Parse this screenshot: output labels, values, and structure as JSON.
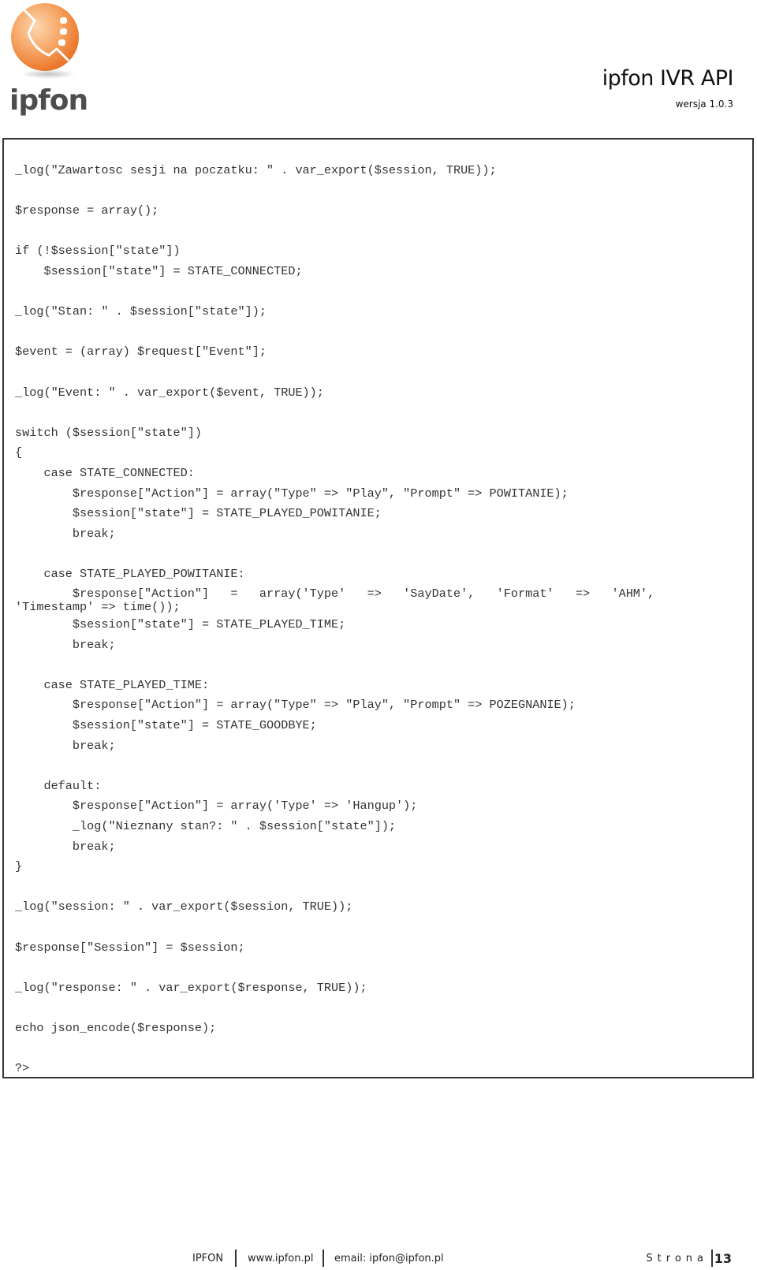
{
  "header": {
    "logo_text": "ipfon",
    "title": "ipfon IVR API",
    "version": "wersja 1.0.3"
  },
  "code": {
    "language": "php",
    "lines": [
      "_log(\"Zawartosc sesji na poczatku: \" . var_export($session, TRUE));",
      "",
      "$response = array();",
      "",
      "if (!$session[\"state\"])",
      "    $session[\"state\"] = STATE_CONNECTED;",
      "",
      "_log(\"Stan: \" . $session[\"state\"]);",
      "",
      "$event = (array) $request[\"Event\"];",
      "",
      "_log(\"Event: \" . var_export($event, TRUE));",
      "",
      "switch ($session[\"state\"])",
      "{",
      "    case STATE_CONNECTED:",
      "        $response[\"Action\"] = array(\"Type\" => \"Play\", \"Prompt\" => POWITANIE);",
      "        $session[\"state\"] = STATE_PLAYED_POWITANIE;",
      "        break;",
      "",
      "    case STATE_PLAYED_POWITANIE:",
      "        $response[\"Action\"]   =   array('Type'   =>   'SayDate',   'Format'   =>   'AHM',",
      "'Timestamp' => time());",
      "        $session[\"state\"] = STATE_PLAYED_TIME;",
      "        break;",
      "",
      "    case STATE_PLAYED_TIME:",
      "        $response[\"Action\"] = array(\"Type\" => \"Play\", \"Prompt\" => POZEGNANIE);",
      "        $session[\"state\"] = STATE_GOODBYE;",
      "        break;",
      "",
      "    default:",
      "        $response[\"Action\"] = array('Type' => 'Hangup');",
      "        _log(\"Nieznany stan?: \" . $session[\"state\"]);",
      "        break;",
      "}",
      "",
      "_log(\"session: \" . var_export($session, TRUE));",
      "",
      "$response[\"Session\"] = $session;",
      "",
      "_log(\"response: \" . var_export($response, TRUE));",
      "",
      "echo json_encode($response);",
      "",
      "?>"
    ]
  },
  "footer": {
    "company": "IPFON",
    "website": "www.ipfon.pl",
    "email": "email: ipfon@ipfon.pl",
    "page_label": "Strona",
    "page_number": "13"
  }
}
